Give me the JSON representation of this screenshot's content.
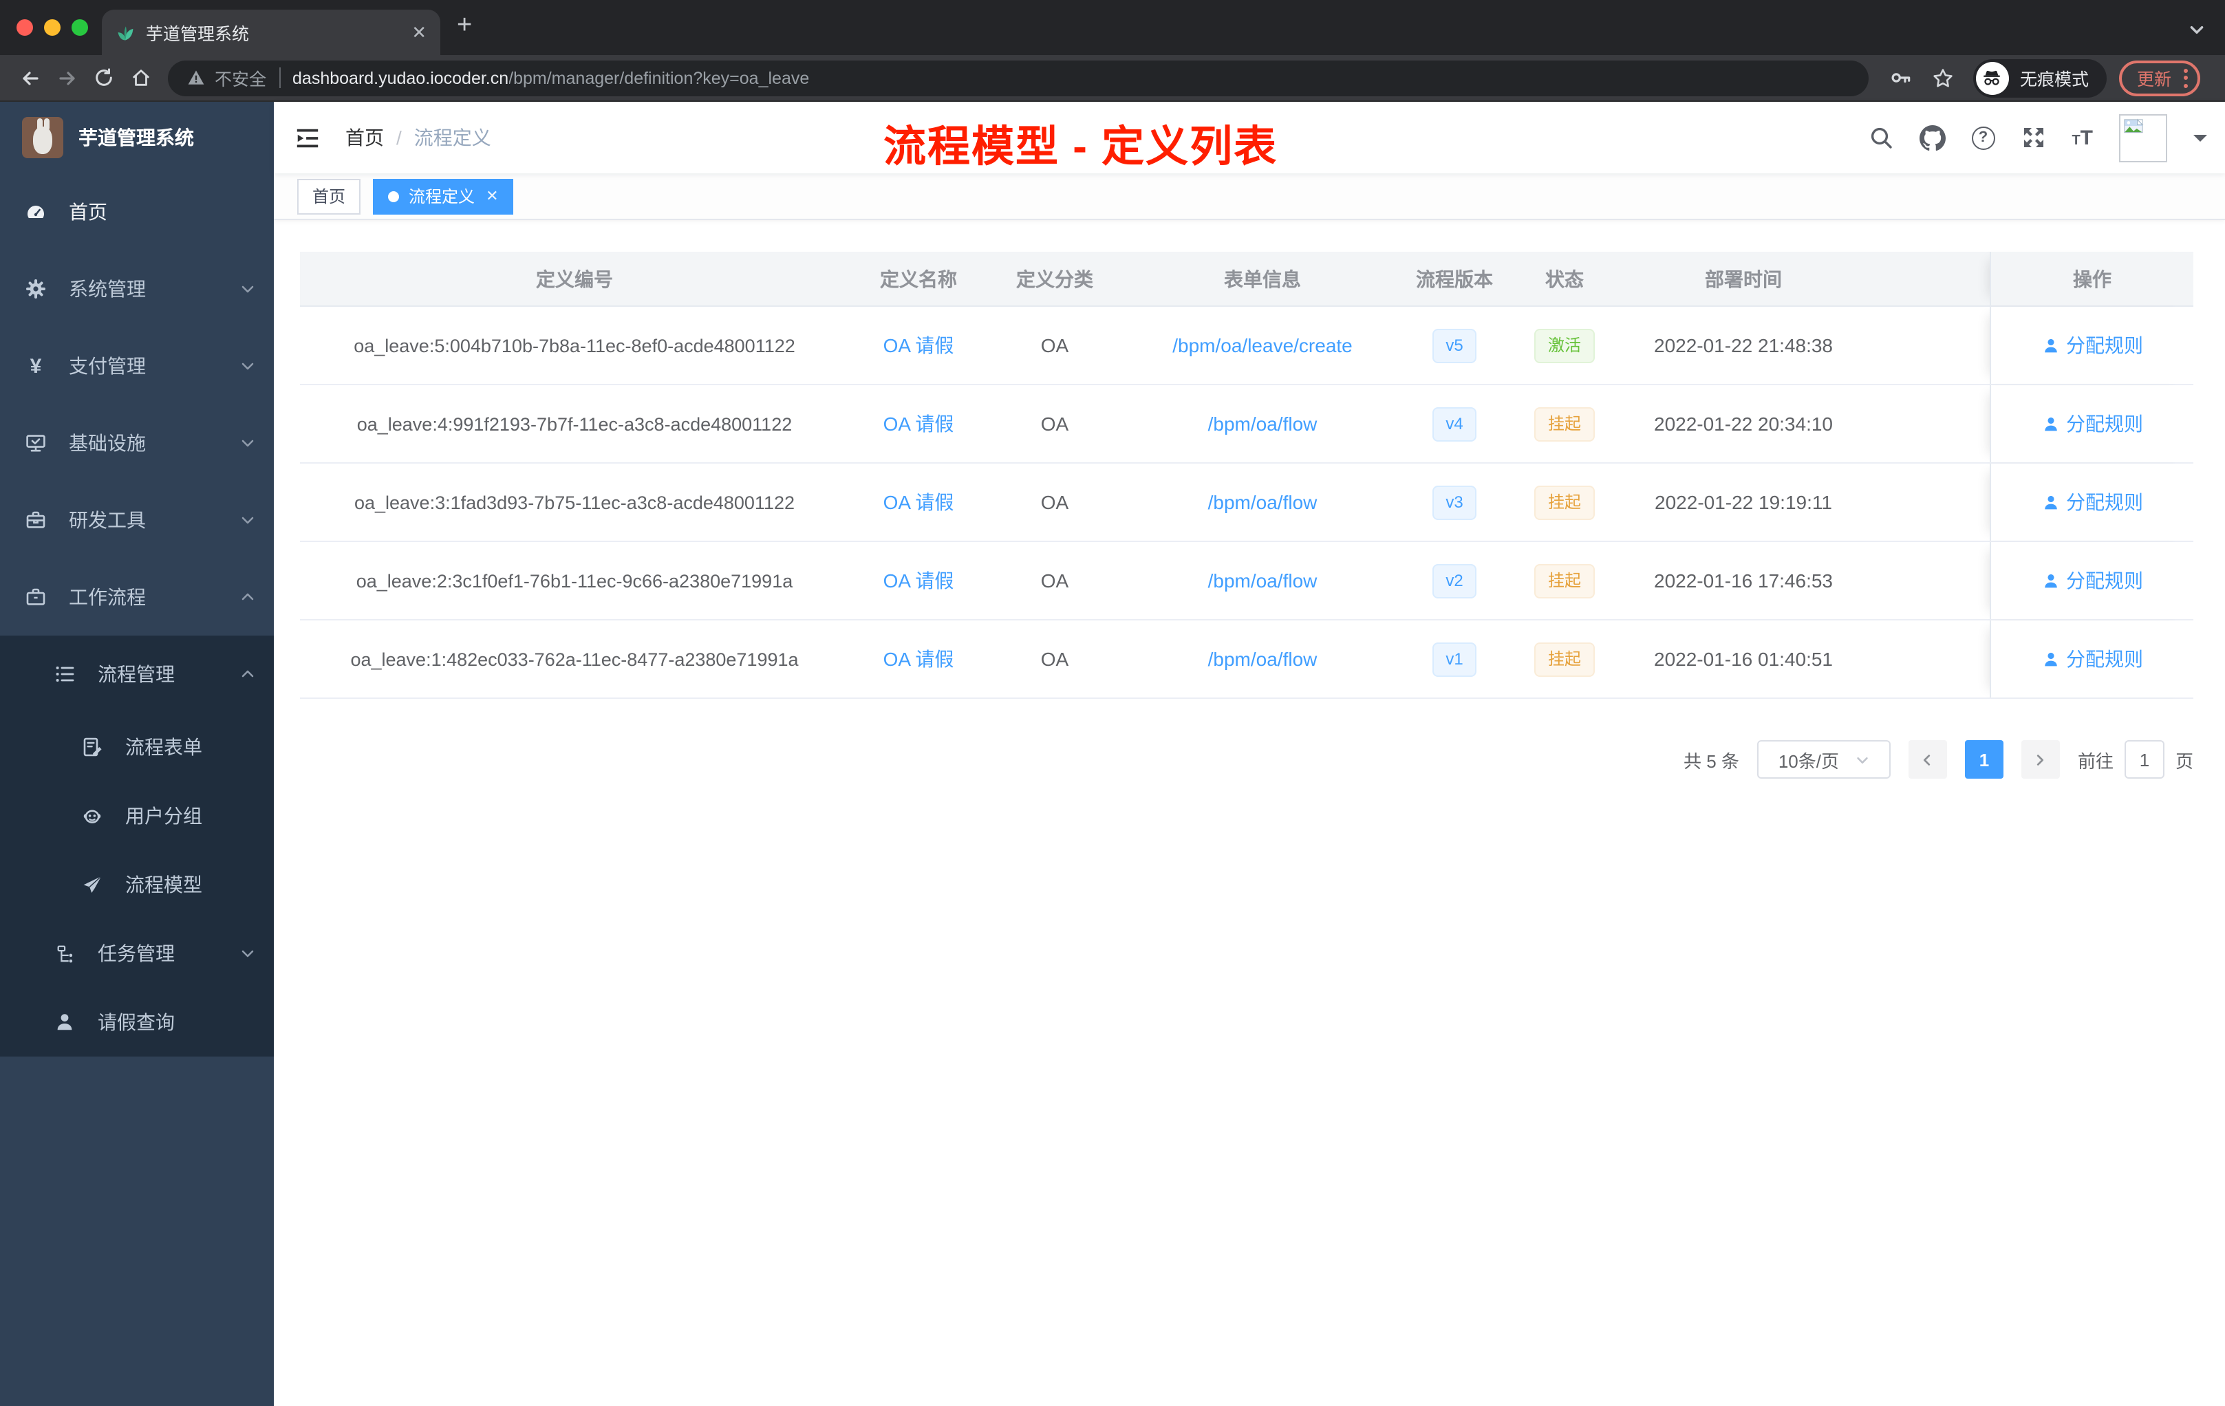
{
  "browser": {
    "tab_title": "芋道管理系统",
    "insecure_label": "不安全",
    "url_domain": "dashboard.yudao.iocoder.cn",
    "url_path": "/bpm/manager/definition?key=oa_leave",
    "incognito_label": "无痕模式",
    "update_label": "更新"
  },
  "sidebar": {
    "logo_title": "芋道管理系统",
    "items": [
      {
        "label": "首页"
      },
      {
        "label": "系统管理"
      },
      {
        "label": "支付管理"
      },
      {
        "label": "基础设施"
      },
      {
        "label": "研发工具"
      },
      {
        "label": "工作流程"
      },
      {
        "label": "流程管理"
      },
      {
        "label": "流程表单"
      },
      {
        "label": "用户分组"
      },
      {
        "label": "流程模型"
      },
      {
        "label": "任务管理"
      },
      {
        "label": "请假查询"
      }
    ]
  },
  "navbar": {
    "breadcrumb_home": "首页",
    "breadcrumb_sep": "/",
    "breadcrumb_current": "流程定义",
    "overlay_title": "流程模型 - 定义列表"
  },
  "tags": [
    {
      "label": "首页"
    },
    {
      "label": "流程定义"
    }
  ],
  "table": {
    "columns": [
      "定义编号",
      "定义名称",
      "定义分类",
      "表单信息",
      "流程版本",
      "状态",
      "部署时间",
      "操作"
    ],
    "rows": [
      {
        "id": "oa_leave:5:004b710b-7b8a-11ec-8ef0-acde48001122",
        "name": "OA 请假",
        "category": "OA",
        "form": "/bpm/oa/leave/create",
        "version": "v5",
        "status": "激活",
        "time": "2022-01-22 21:48:38",
        "action": "分配规则"
      },
      {
        "id": "oa_leave:4:991f2193-7b7f-11ec-a3c8-acde48001122",
        "name": "OA 请假",
        "category": "OA",
        "form": "/bpm/oa/flow",
        "version": "v4",
        "status": "挂起",
        "time": "2022-01-22 20:34:10",
        "action": "分配规则"
      },
      {
        "id": "oa_leave:3:1fad3d93-7b75-11ec-a3c8-acde48001122",
        "name": "OA 请假",
        "category": "OA",
        "form": "/bpm/oa/flow",
        "version": "v3",
        "status": "挂起",
        "time": "2022-01-22 19:19:11",
        "action": "分配规则"
      },
      {
        "id": "oa_leave:2:3c1f0ef1-76b1-11ec-9c66-a2380e71991a",
        "name": "OA 请假",
        "category": "OA",
        "form": "/bpm/oa/flow",
        "version": "v2",
        "status": "挂起",
        "time": "2022-01-16 17:46:53",
        "action": "分配规则"
      },
      {
        "id": "oa_leave:1:482ec033-762a-11ec-8477-a2380e71991a",
        "name": "OA 请假",
        "category": "OA",
        "form": "/bpm/oa/flow",
        "version": "v1",
        "status": "挂起",
        "time": "2022-01-16 01:40:51",
        "action": "分配规则"
      }
    ]
  },
  "pagination": {
    "total": "共 5 条",
    "page_size": "10条/页",
    "current_page": "1",
    "goto_label": "前往",
    "goto_value": "1",
    "unit_label": "页"
  },
  "colors": {
    "accent": "#409eff",
    "sidebar_bg": "#304156",
    "submenu_bg": "#1f2d3d",
    "active_green": "#67c23a",
    "suspend_orange": "#e6a23c",
    "annotation_red": "#ff1f00"
  }
}
